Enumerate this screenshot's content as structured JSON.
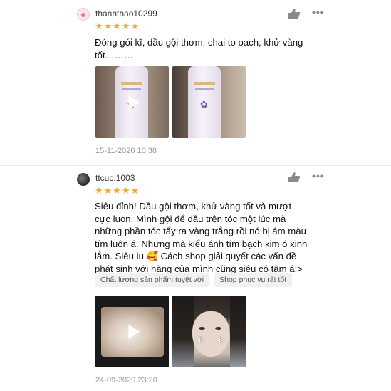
{
  "reviews": [
    {
      "username": "thanhthao10299",
      "stars": "★★★★★",
      "text": "Đóng gói kĩ, dầu gội thơm, chai to oạch, khử vàng tốt………",
      "tags": [],
      "media": [
        {
          "type": "video",
          "icon": "play-icon",
          "subject": "shampoo-bottle"
        },
        {
          "type": "photo",
          "subject": "shampoo-bottle"
        }
      ],
      "date": "15-11-2020 10:38",
      "actions": {
        "like_icon": "thumbs-up-icon",
        "more_icon": "more-dots-icon",
        "more_label": "•••"
      }
    },
    {
      "username": "ttcuc.1003",
      "stars": "★★★★★",
      "text": "Siêu đỉnh! Dầu gội thơm, khử vàng tốt và mượt cực luon. Mình gội để dầu trên tóc một lúc mà những phần tóc tẩy ra vàng trắng rồi nó bị ám màu tím luôn á. Nhưng mà kiểu ánh tím bạch kim ó xinh lắm. Siêu iu 🥰 Cách shop giải quyết các vấn đề phát sinh với hàng của mình cũng siêu có tâm á:>",
      "tags": [
        "Chất lượng sản phẩm tuyệt vời",
        "Shop phục vụ rất tốt"
      ],
      "media": [
        {
          "type": "video",
          "icon": "play-icon",
          "subject": "cat"
        },
        {
          "type": "photo",
          "subject": "selfie"
        }
      ],
      "date": "24-09-2020 23:20",
      "actions": {
        "like_icon": "thumbs-up-icon",
        "more_icon": "more-dots-icon",
        "more_label": "•••"
      }
    }
  ],
  "colors": {
    "star": "#f5a623",
    "date": "#9a9a9a",
    "tag_bg": "#f1f1f1",
    "icon": "#8a8a8a"
  }
}
